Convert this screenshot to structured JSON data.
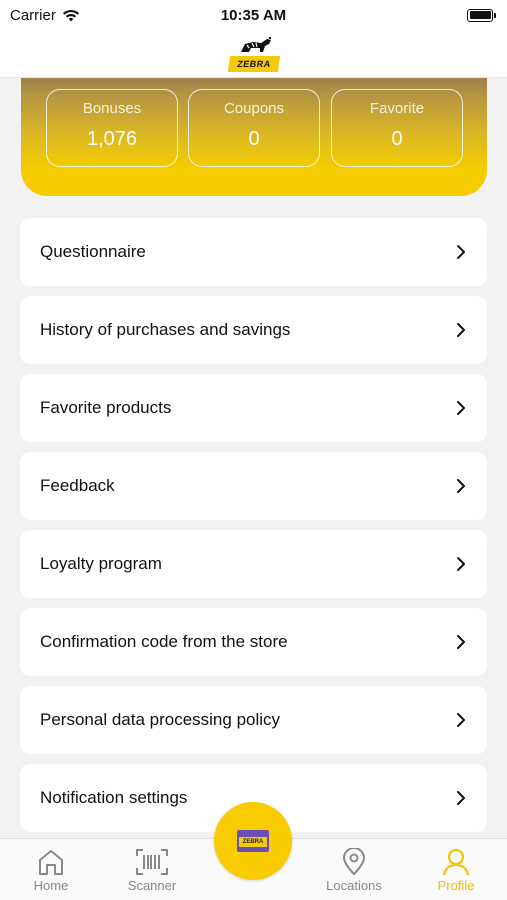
{
  "status_bar": {
    "carrier": "Carrier",
    "time": "10:35 AM"
  },
  "header": {
    "logo_text": "ZEBRA"
  },
  "stats": [
    {
      "label": "Bonuses",
      "value": "1,076"
    },
    {
      "label": "Coupons",
      "value": "0"
    },
    {
      "label": "Favorite",
      "value": "0"
    }
  ],
  "menu": [
    {
      "label": "Questionnaire"
    },
    {
      "label": "History of purchases and savings"
    },
    {
      "label": "Favorite products"
    },
    {
      "label": "Feedback"
    },
    {
      "label": "Loyalty program"
    },
    {
      "label": "Confirmation code from the store"
    },
    {
      "label": "Personal data processing policy"
    },
    {
      "label": "Notification settings"
    }
  ],
  "tabs": {
    "home": "Home",
    "scanner": "Scanner",
    "locations": "Locations",
    "profile": "Profile"
  },
  "fab": {
    "card_text": "ZEBRA"
  },
  "colors": {
    "accent": "#f8cc00",
    "active_tab": "#f0c400",
    "inactive_tab": "#888888"
  }
}
